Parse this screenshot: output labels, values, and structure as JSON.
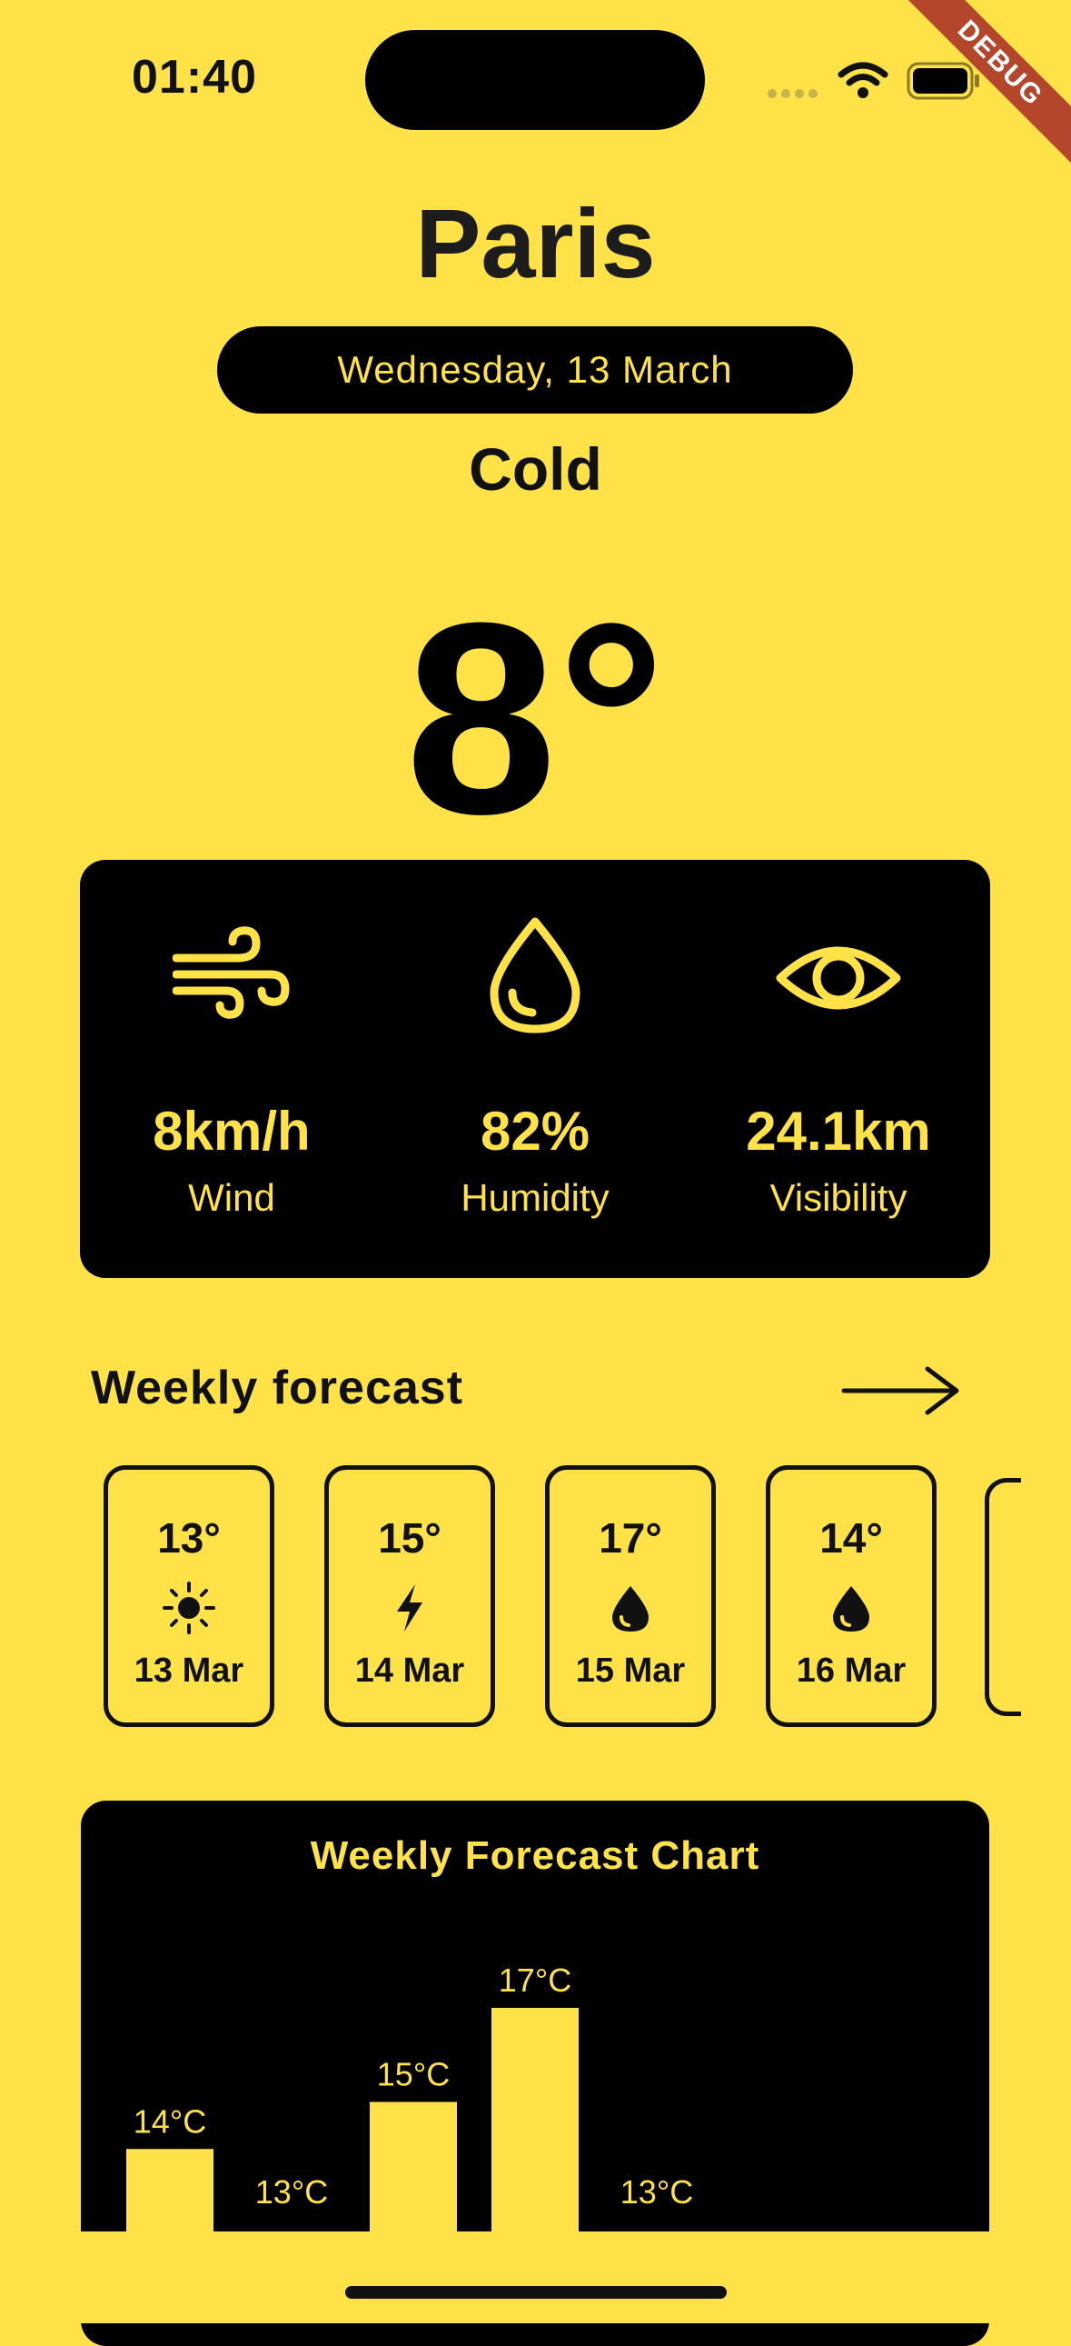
{
  "status_bar": {
    "time": "01:40"
  },
  "debug_banner": "DEBUG",
  "city": "Paris",
  "date": "Wednesday, 13 March",
  "condition": "Cold",
  "temperature": "8°",
  "stats": [
    {
      "icon": "wind-icon",
      "value": "8km/h",
      "label": "Wind"
    },
    {
      "icon": "humidity-drop-icon",
      "value": "82%",
      "label": "Humidity"
    },
    {
      "icon": "eye-icon",
      "value": "24.1km",
      "label": "Visibility"
    }
  ],
  "weekly": {
    "title": "Weekly forecast",
    "days": [
      {
        "temp": "13°",
        "icon": "sun-icon",
        "date": "13 Mar"
      },
      {
        "temp": "15°",
        "icon": "lightning-icon",
        "date": "14 Mar"
      },
      {
        "temp": "17°",
        "icon": "drop-icon",
        "date": "15 Mar"
      },
      {
        "temp": "14°",
        "icon": "drop-icon",
        "date": "16 Mar"
      }
    ]
  },
  "colors": {
    "accent": "#FFE247",
    "dark": "#000000",
    "ribbon": "#B4462C"
  },
  "chart_data": {
    "type": "bar",
    "title": "Weekly Forecast Chart",
    "categories": [
      "",
      "",
      "",
      "",
      ""
    ],
    "values": [
      14,
      13,
      15,
      17,
      13
    ],
    "labels": [
      "14°C",
      "13°C",
      "15°C",
      "17°C",
      "13°C"
    ],
    "ylim": [
      13,
      17
    ],
    "grid": false
  }
}
